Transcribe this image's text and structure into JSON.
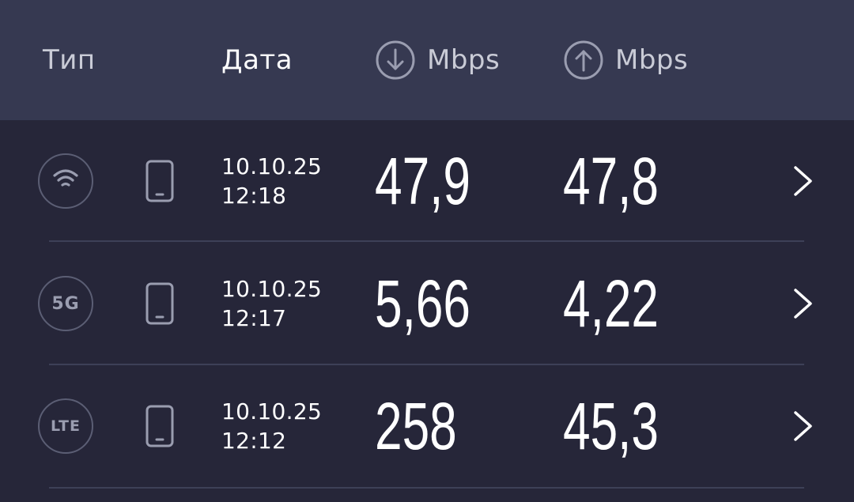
{
  "header": {
    "type_label": "Тип",
    "date_label": "Дата",
    "download_label": "Mbps",
    "upload_label": "Mbps",
    "download_icon": "arrow-down-circle-icon",
    "upload_icon": "arrow-up-circle-icon"
  },
  "results": [
    {
      "type_icon": "wifi-icon",
      "type_label": "",
      "device_icon": "phone-icon",
      "date": "10.10.25",
      "time": "12:18",
      "download": "47,9",
      "upload": "47,8"
    },
    {
      "type_icon": "5g-badge",
      "type_label": "5G",
      "device_icon": "phone-icon",
      "date": "10.10.25",
      "time": "12:17",
      "download": "5,66",
      "upload": "4,22"
    },
    {
      "type_icon": "lte-badge",
      "type_label": "LTE",
      "device_icon": "phone-icon",
      "date": "10.10.25",
      "time": "12:12",
      "download": "258",
      "upload": "45,3"
    }
  ],
  "colors": {
    "header_bg": "#363951",
    "list_bg": "#262639",
    "divider": "#3d4057",
    "muted_text": "#c9cbd6",
    "icon_gray": "#9a9db0",
    "value_text": "#ffffff"
  }
}
